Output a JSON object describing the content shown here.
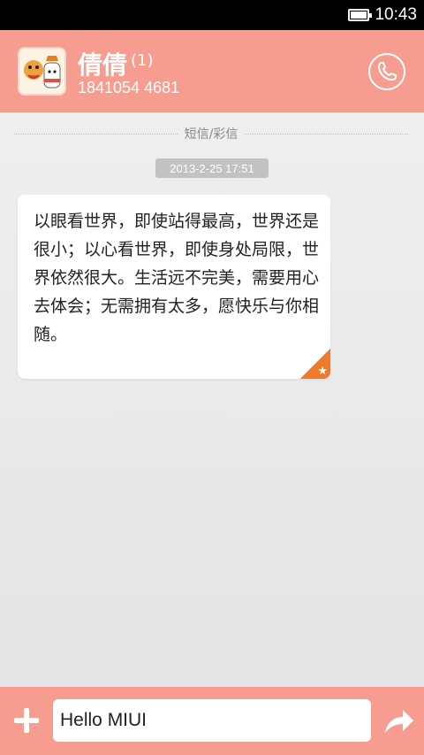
{
  "status_bar": {
    "time": "10:43",
    "battery_icon": "battery-full-icon"
  },
  "header": {
    "contact_name": "倩倩",
    "unread_count": "(1)",
    "phone_number": "1841054 4681",
    "call_icon": "phone-icon",
    "avatar_icon": "avatar-icon"
  },
  "conversation": {
    "divider_label": "短信/彩信",
    "timestamp": "2013-2-25 17:51",
    "messages": [
      {
        "text": "以眼看世界，即使站得最高，世界还是很小；以心看世界，即使身处局限，世界依然很大。生活远不完美，需要用心去体会；无需拥有太多，愿快乐与你相随。",
        "starred": true,
        "star_glyph": "★"
      }
    ]
  },
  "composer": {
    "add_icon": "plus-icon",
    "input_value": "Hello MIUI",
    "send_icon": "send-arrow-icon"
  },
  "colors": {
    "accent": "#f79d8f",
    "star": "#f07a2a"
  }
}
